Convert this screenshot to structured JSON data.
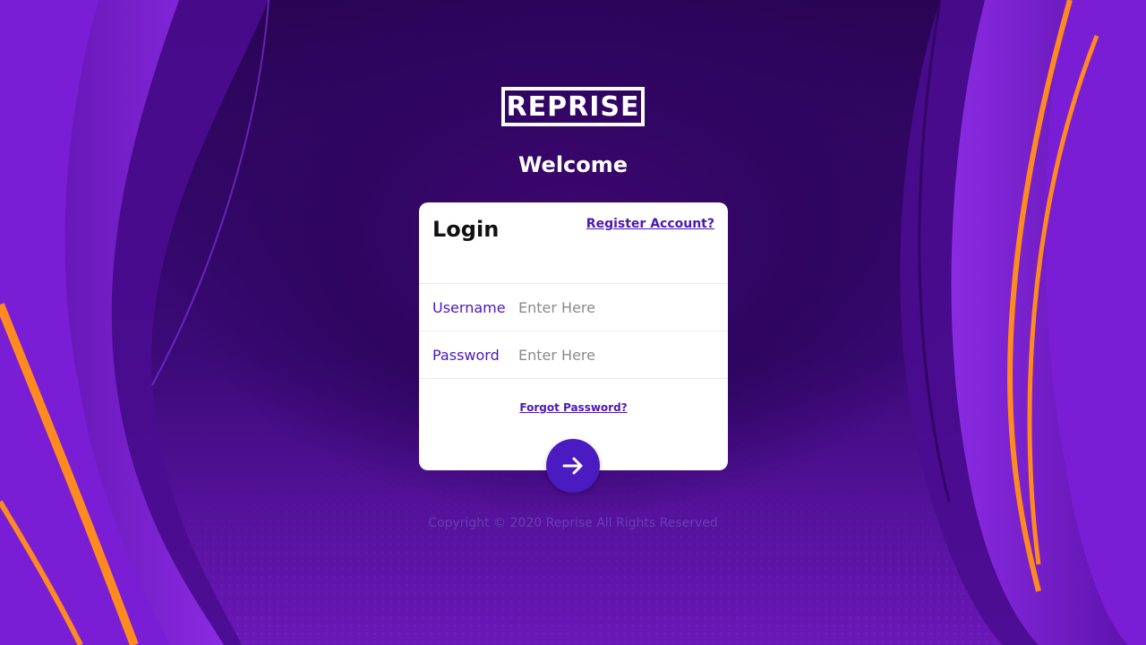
{
  "brand": {
    "logo_text": "REPRISE"
  },
  "page": {
    "welcome": "Welcome"
  },
  "login": {
    "title": "Login",
    "register_link": "Register Account?",
    "username": {
      "label": "Username",
      "placeholder": "Enter Here"
    },
    "password": {
      "label": "Password",
      "placeholder": "Enter Here"
    },
    "forgot_link": "Forgot Password?",
    "submit_icon": "arrow-right-icon"
  },
  "footer": {
    "copyright": "Copyright © 2020 Reprise All Rights Reserved"
  },
  "colors": {
    "accent": "#4b1bc2",
    "link": "#4b18b8",
    "background_dark": "#2e0560",
    "swoosh_purple": "#7b1fd6",
    "swoosh_orange": "#ff8a1f"
  }
}
